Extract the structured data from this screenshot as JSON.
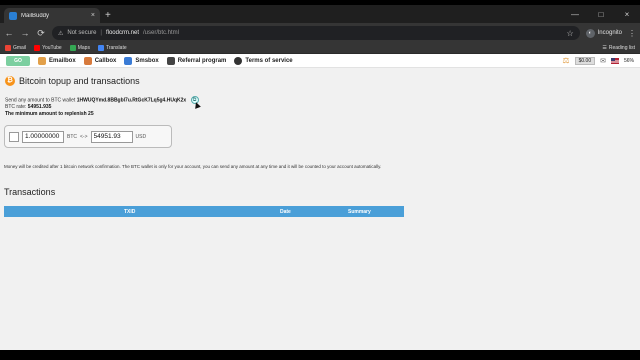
{
  "browser": {
    "tab_title": "MailBuddy",
    "tab_close": "×",
    "new_tab": "+",
    "window_controls": [
      "—",
      "□",
      "×"
    ],
    "nav": {
      "back": "←",
      "forward": "→",
      "reload": "⟳"
    },
    "security_label": "Not secure",
    "url_host": "floodcrm.net",
    "url_path": "/user/btc.html",
    "star": "☆",
    "profile_label": "Incognito",
    "menu": "⋮"
  },
  "bookmarks": {
    "items": [
      {
        "label": "Gmail",
        "color": "#ea4335"
      },
      {
        "label": "YouTube",
        "color": "#ff0000"
      },
      {
        "label": "Maps",
        "color": "#34a853"
      },
      {
        "label": "Translate",
        "color": "#4285f4"
      }
    ],
    "reading_list": "Reading list"
  },
  "site": {
    "logo_text": "GO",
    "nav": [
      {
        "label": "Emailbox",
        "color": "#e2a04a"
      },
      {
        "label": "Callbox",
        "color": "#d77a3c"
      },
      {
        "label": "Smsbox",
        "color": "#3a7bd5"
      },
      {
        "label": "Referral program",
        "color": "#444444"
      },
      {
        "label": "Terms of service",
        "color": "#333333"
      }
    ],
    "balance": "$0.00",
    "battery": "56%"
  },
  "page": {
    "title": "Bitcoin topup and transactions",
    "send_prefix": "Send any amount to BTC wallet",
    "wallet": "1HWUQYmd.8BBgbl7u.RtGcK7Lq5g4.HUqK2x",
    "btc_rate_label": "BTC rate:",
    "btc_rate_value": "54951.935",
    "min_amount": "The minimum amount to replenish 25",
    "converter": {
      "btc_value": "1.00000000",
      "btc_unit": "BTC",
      "arrow": "<->",
      "usd_value": "54951.93",
      "usd_unit": "USD"
    },
    "notice": "Money will be credited after 1 bitcoin network confirmation. The BTC wallet is only for your account, you can send any amount at any time and it will be counted to your account automatically.",
    "transactions_title": "Transactions",
    "table_headers": {
      "txid": "TXID",
      "date": "Date",
      "summary": "Summary"
    }
  }
}
